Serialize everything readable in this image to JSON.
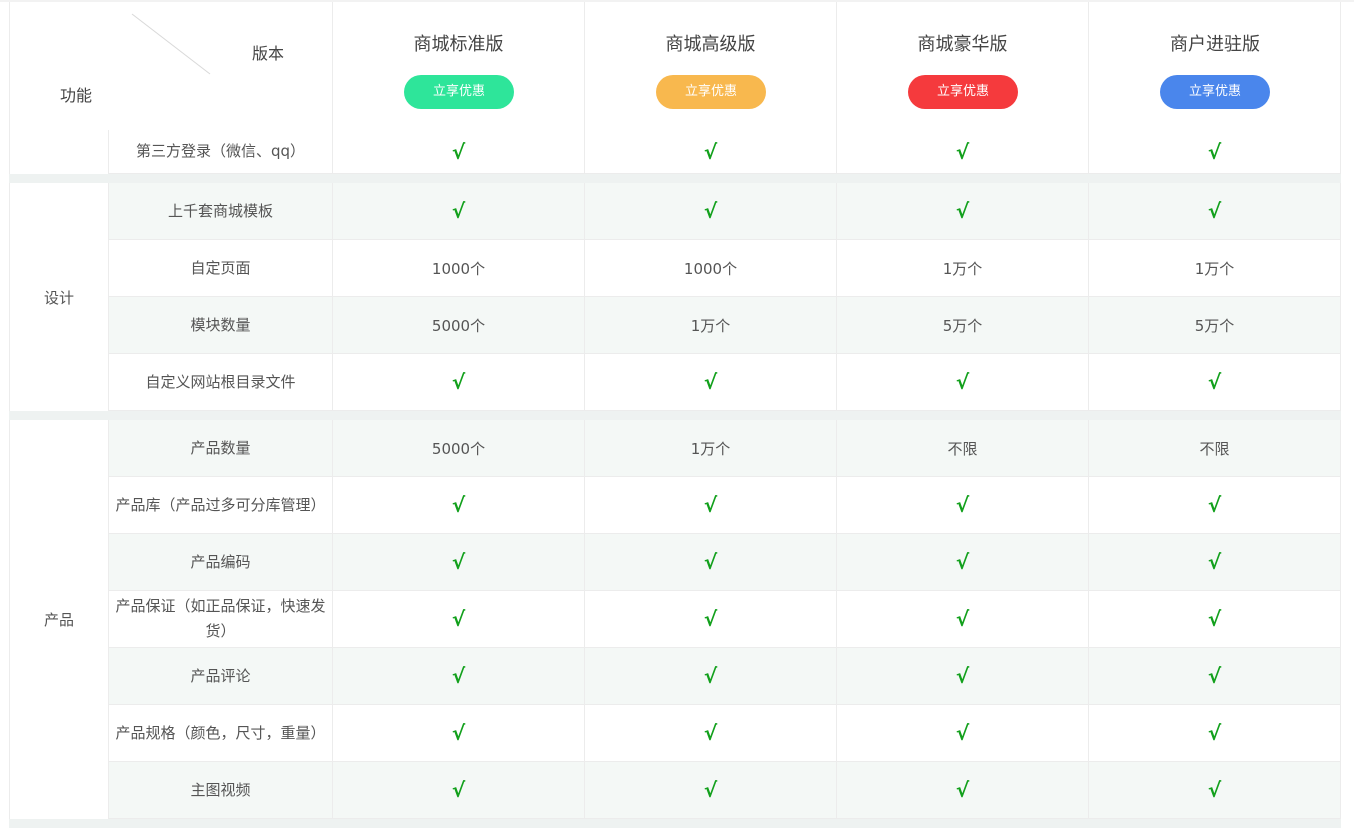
{
  "header": {
    "version_label": "版本",
    "function_label": "功能",
    "plans": [
      {
        "name": "商城标准版",
        "button": "立享优惠",
        "color": "#2ee59a"
      },
      {
        "name": "商城高级版",
        "button": "立享优惠",
        "color": "#f8b84e"
      },
      {
        "name": "商城豪华版",
        "button": "立享优惠",
        "color": "#f53a3d"
      },
      {
        "name": "商户进驻版",
        "button": "立享优惠",
        "color": "#4a86ec"
      }
    ]
  },
  "check_symbol": "√",
  "groups": [
    {
      "category": "",
      "rows": [
        {
          "feature": "第三方登录（微信、qq）",
          "values": [
            "√",
            "√",
            "√",
            "√"
          ]
        }
      ]
    },
    {
      "category": "设计",
      "rows": [
        {
          "feature": "上千套商城模板",
          "values": [
            "√",
            "√",
            "√",
            "√"
          ]
        },
        {
          "feature": "自定页面",
          "values": [
            "1000个",
            "1000个",
            "1万个",
            "1万个"
          ]
        },
        {
          "feature": "模块数量",
          "values": [
            "5000个",
            "1万个",
            "5万个",
            "5万个"
          ]
        },
        {
          "feature": "自定义网站根目录文件",
          "values": [
            "√",
            "√",
            "√",
            "√"
          ]
        }
      ]
    },
    {
      "category": "产品",
      "rows": [
        {
          "feature": "产品数量",
          "values": [
            "5000个",
            "1万个",
            "不限",
            "不限"
          ]
        },
        {
          "feature": "产品库（产品过多可分库管理）",
          "values": [
            "√",
            "√",
            "√",
            "√"
          ]
        },
        {
          "feature": "产品编码",
          "values": [
            "√",
            "√",
            "√",
            "√"
          ]
        },
        {
          "feature": "产品保证（如正品保证，快速发货）",
          "values": [
            "√",
            "√",
            "√",
            "√"
          ]
        },
        {
          "feature": "产品评论",
          "values": [
            "√",
            "√",
            "√",
            "√"
          ]
        },
        {
          "feature": "产品规格（颜色，尺寸，重量）",
          "values": [
            "√",
            "√",
            "√",
            "√"
          ]
        },
        {
          "feature": "主图视频",
          "values": [
            "√",
            "√",
            "√",
            "√"
          ]
        }
      ]
    }
  ]
}
